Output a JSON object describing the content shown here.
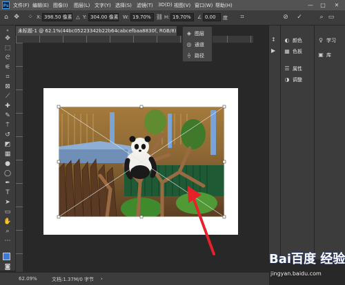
{
  "app": {
    "logo_text": "Ps"
  },
  "menu": [
    "文件(F)",
    "编辑(E)",
    "图像(I)",
    "图层(L)",
    "文字(Y)",
    "选择(S)",
    "滤镜(T)",
    "3D(D)",
    "视图(V)",
    "窗口(W)",
    "帮助(H)"
  ],
  "window_controls": [
    "—",
    "□",
    "✕"
  ],
  "options_bar": {
    "x_label": "X:",
    "x_value": "398.50 像素",
    "y_label": "Y:",
    "y_value": "304.00 像素",
    "w_label": "W:",
    "w_value": "19.70%",
    "h_label": "H:",
    "h_value": "19.70%",
    "angle_label": "∠",
    "angle_value": "0.00",
    "angle_unit": "度"
  },
  "document": {
    "tab_title": "未标题-1 @ 62.1%(44bc05223342b22b64cabcefbaa8830f, RGB/8) *",
    "close": "×"
  },
  "floating_panel": {
    "items": [
      {
        "label": "图层",
        "icon": "layers-icon"
      },
      {
        "label": "通道",
        "icon": "channels-icon"
      },
      {
        "label": "路径",
        "icon": "paths-icon"
      }
    ]
  },
  "dock": {
    "panel_a": [
      {
        "label": "颜色",
        "icon": "color-icon"
      },
      {
        "label": "色板",
        "icon": "swatches-icon"
      },
      {
        "label": "属性",
        "icon": "properties-icon"
      },
      {
        "label": "调整",
        "icon": "adjustments-icon"
      }
    ],
    "panel_b": [
      {
        "label": "学习",
        "icon": "learn-icon"
      },
      {
        "label": "库",
        "icon": "libraries-icon"
      }
    ]
  },
  "status": {
    "zoom": "62.09%",
    "doc_info": "文档:1.37M/0 字节"
  },
  "watermark": {
    "logo": "Bai百度 经验",
    "url": "jingyan.baidu.com"
  },
  "colors": {
    "accent": "#31a8ff",
    "arrow": "#e8202a",
    "panel": "#3c3c3c",
    "bg": "#282828"
  }
}
